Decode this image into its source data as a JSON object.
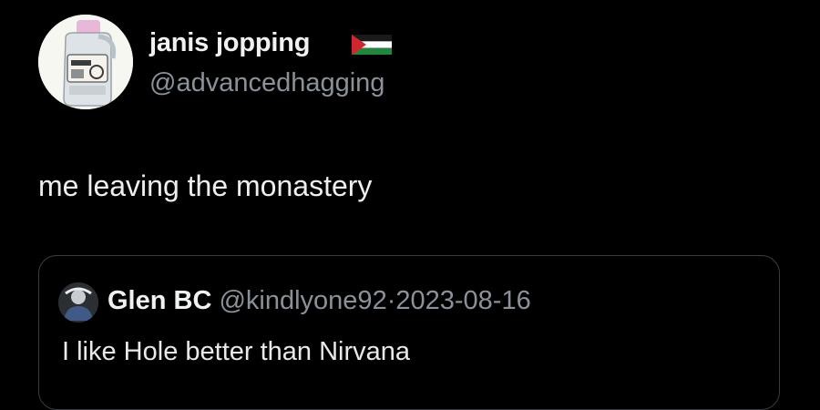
{
  "post": {
    "author": {
      "display_name": "janis jopping",
      "handle": "@advancedhagging",
      "flag_icon": "palestine-flag-icon",
      "avatar_icon": "detergent-bottle-avatar"
    },
    "text": "me leaving the monastery",
    "quote": {
      "display_name": "Glen BC",
      "handle": "@kindlyone92",
      "separator": "·",
      "date": "2023-08-16",
      "text": "I like Hole better than Nirvana",
      "avatar_icon": "user-avatar"
    }
  },
  "colors": {
    "background": "#000000",
    "primary_text": "#e7e9ea",
    "secondary_text": "#8b9199",
    "card_border": "#3a3d40"
  }
}
